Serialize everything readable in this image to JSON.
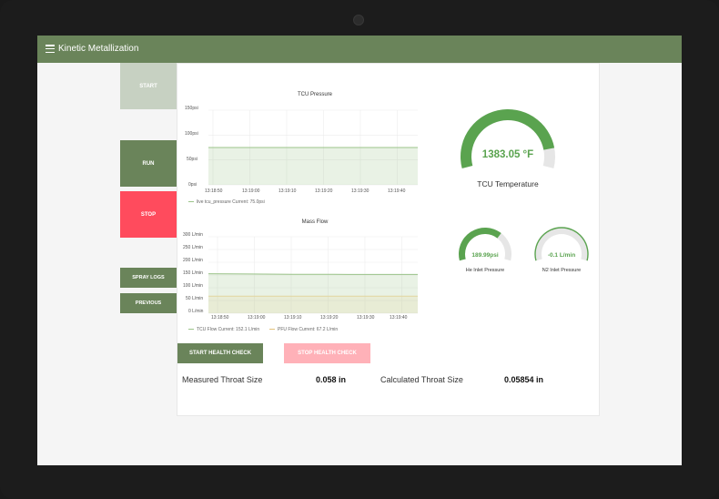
{
  "app": {
    "title": "Kinetic Metallization"
  },
  "sidebar": {
    "start_label": "START",
    "run_label": "RUN",
    "stop_label": "STOP",
    "spray_logs_label": "SPRAY LOGS",
    "previous_label": "PREVIOUS"
  },
  "charts": {
    "pressure": {
      "title": "TCU Pressure",
      "y_ticks": [
        "150psi",
        "100psi",
        "50psi",
        "0psi"
      ],
      "x_ticks": [
        "13:18:50",
        "13:19:00",
        "13:19:10",
        "13:19:20",
        "13:19:30",
        "13:19:40"
      ],
      "legend": "live tcu_pressure  Current: 75.0psi"
    },
    "massflow": {
      "title": "Mass Flow",
      "y_ticks": [
        "300 L/min",
        "250 L/min",
        "200 L/min",
        "150 L/min",
        "100 L/min",
        "50 L/min",
        "0 L/min"
      ],
      "x_ticks": [
        "13:18:50",
        "13:19:00",
        "13:19:10",
        "13:19:20",
        "13:19:30",
        "13:19:40"
      ],
      "legend_tcu": "TCU Flow  Current: 152.1 L/min",
      "legend_pfu": "PFU Flow  Current: 67.2 L/min"
    }
  },
  "chart_data": [
    {
      "type": "line",
      "title": "TCU Pressure",
      "x": [
        "13:18:50",
        "13:19:00",
        "13:19:10",
        "13:19:20",
        "13:19:30",
        "13:19:40"
      ],
      "ylim": [
        0,
        150
      ],
      "series": [
        {
          "name": "live tcu_pressure",
          "values": [
            75,
            75,
            75,
            75,
            75,
            75
          ],
          "color": "#9cc48a"
        }
      ]
    },
    {
      "type": "area",
      "title": "Mass Flow",
      "x": [
        "13:18:50",
        "13:19:00",
        "13:19:10",
        "13:19:20",
        "13:19:30",
        "13:19:40"
      ],
      "ylim": [
        0,
        300
      ],
      "series": [
        {
          "name": "TCU Flow",
          "values": [
            155,
            154,
            153,
            152.5,
            152.2,
            152.1
          ],
          "color": "#9cc48a"
        },
        {
          "name": "PFU Flow",
          "values": [
            67.2,
            67.2,
            67.2,
            67.2,
            67.2,
            67.2
          ],
          "color": "#e2d5a0"
        }
      ]
    }
  ],
  "gauges": {
    "tcu_temp": {
      "value_text": "1383.05 °F",
      "label": "TCU Temperature",
      "fraction": 0.88
    },
    "he_inlet": {
      "value_text": "189.99psi",
      "label": "He Inlet Pressure",
      "fraction": 0.68
    },
    "n2_inlet": {
      "value_text": "-0.1 L/min",
      "label": "N2 Inlet Pressure",
      "fraction": 0.0
    }
  },
  "health": {
    "start_label": "START HEALTH CHECK",
    "stop_label": "STOP HEALTH CHECK"
  },
  "throat": {
    "measured_label": "Measured Throat Size",
    "measured_value": "0.058 in",
    "calculated_label": "Calculated Throat Size",
    "calculated_value": "0.05854 in"
  },
  "colors": {
    "accent": "#6a845a",
    "stop": "#ff4b5d",
    "gauge_fill": "#5aa34f",
    "gauge_track": "#e6e6e6"
  }
}
